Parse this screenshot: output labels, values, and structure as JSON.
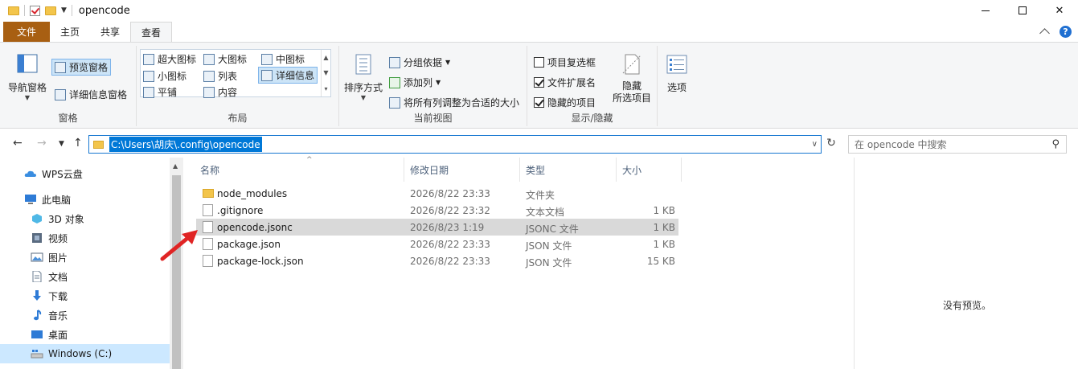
{
  "window": {
    "title": "opencode",
    "minimize_glyph": "",
    "close_glyph": "✕"
  },
  "ribbon_tabs": {
    "file": "文件",
    "home": "主页",
    "share": "共享",
    "view": "查看"
  },
  "ribbon": {
    "panes": {
      "label": "窗格",
      "nav_pane": "导航窗格",
      "preview_pane": "预览窗格",
      "details_pane": "详细信息窗格"
    },
    "layout": {
      "label": "布局",
      "items": [
        "超大图标",
        "大图标",
        "中图标",
        "小图标",
        "列表",
        "详细信息",
        "平铺",
        "内容"
      ],
      "selected": "详细信息"
    },
    "current_view": {
      "label": "当前视图",
      "sort_by": "排序方式",
      "group_by": "分组依据",
      "add_columns": "添加列",
      "size_all_columns": "将所有列调整为合适的大小"
    },
    "show_hide": {
      "label": "显示/隐藏",
      "item_checkboxes": {
        "text": "项目复选框",
        "checked": false
      },
      "file_extensions": {
        "text": "文件扩展名",
        "checked": true
      },
      "hidden_items": {
        "text": "隐藏的项目",
        "checked": true
      },
      "hide_selected": "隐藏\n所选项目"
    },
    "options": "选项"
  },
  "address": {
    "path": "C:\\Users\\胡庆\\.config\\opencode"
  },
  "search": {
    "placeholder": "在 opencode 中搜索"
  },
  "nav_pane": {
    "items": [
      {
        "label": "WPS云盘",
        "icon": "cloud-icon"
      },
      {
        "label": "此电脑",
        "icon": "computer-icon"
      },
      {
        "label": "3D 对象",
        "icon": "3d-objects-icon"
      },
      {
        "label": "视频",
        "icon": "video-icon"
      },
      {
        "label": "图片",
        "icon": "pictures-icon"
      },
      {
        "label": "文档",
        "icon": "documents-icon"
      },
      {
        "label": "下载",
        "icon": "download-icon"
      },
      {
        "label": "音乐",
        "icon": "music-icon"
      },
      {
        "label": "桌面",
        "icon": "desktop-icon"
      },
      {
        "label": "Windows (C:)",
        "icon": "drive-icon"
      }
    ],
    "selected": "Windows (C:)"
  },
  "columns": {
    "name": "名称",
    "date": "修改日期",
    "type": "类型",
    "size": "大小"
  },
  "files": [
    {
      "name": "node_modules",
      "date": "2026/8/22 23:33",
      "type": "文件夹",
      "size": "",
      "icon": "folder-icon"
    },
    {
      "name": ".gitignore",
      "date": "2026/8/22 23:32",
      "type": "文本文档",
      "size": "1 KB",
      "icon": "text-file-icon"
    },
    {
      "name": "opencode.jsonc",
      "date": "2026/8/23 1:19",
      "type": "JSONC 文件",
      "size": "1 KB",
      "icon": "file-icon"
    },
    {
      "name": "package.json",
      "date": "2026/8/22 23:33",
      "type": "JSON 文件",
      "size": "1 KB",
      "icon": "file-icon"
    },
    {
      "name": "package-lock.json",
      "date": "2026/8/22 23:33",
      "type": "JSON 文件",
      "size": "15 KB",
      "icon": "file-icon"
    }
  ],
  "selected_file": "opencode.jsonc",
  "preview": {
    "text": "没有预览。"
  },
  "colors": {
    "file_tab": "#a85f12",
    "selection": "#cce8ff",
    "address_border": "#1777d1",
    "annotation_arrow": "#e02424"
  }
}
